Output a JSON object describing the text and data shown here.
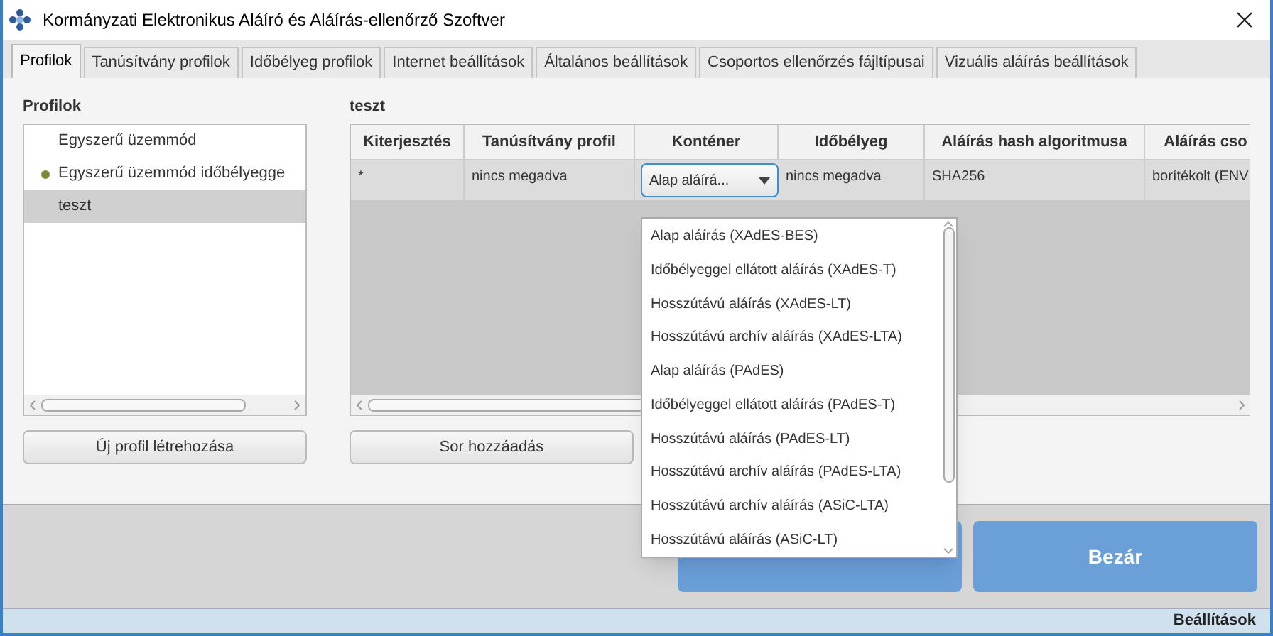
{
  "window": {
    "title": "Kormányzati Elektronikus Aláíró és Aláírás-ellenőrző Szoftver"
  },
  "tabs": [
    {
      "label": "Profilok",
      "selected": true
    },
    {
      "label": "Tanúsítvány profilok",
      "selected": false
    },
    {
      "label": "Időbélyeg profilok",
      "selected": false
    },
    {
      "label": "Internet beállítások",
      "selected": false
    },
    {
      "label": "Általános beállítások",
      "selected": false
    },
    {
      "label": "Csoportos ellenőrzés fájltípusai",
      "selected": false
    },
    {
      "label": "Vizuális aláírás beállítások",
      "selected": false
    }
  ],
  "profiles": {
    "heading": "Profilok",
    "items": [
      {
        "label": "Egyszerű üzemmód",
        "active": false,
        "selected": false
      },
      {
        "label": "Egyszerű üzemmód időbélyegge",
        "active": true,
        "selected": false
      },
      {
        "label": "teszt",
        "active": false,
        "selected": true
      }
    ],
    "button": "Új profil létrehozása"
  },
  "profile_detail": {
    "heading": "teszt",
    "table": {
      "columns": [
        "Kiterjesztés",
        "Tanúsítvány profil",
        "Konténer",
        "Időbélyeg",
        "Aláírás hash algoritmusa",
        "Aláírás cso"
      ],
      "rows": [
        [
          "*",
          "nincs megadva",
          {
            "kind": "combo",
            "value": "Alap aláírá..."
          },
          "nincs megadva",
          "SHA256",
          "borítékolt (ENV"
        ]
      ]
    },
    "button": "Sor hozzáadás"
  },
  "dropdown": {
    "options": [
      {
        "label": "Alap aláírás (XAdES-BES)",
        "selected": false
      },
      {
        "label": "Időbélyeggel ellátott aláírás (XAdES-T)",
        "selected": false
      },
      {
        "label": "Hosszútávú aláírás (XAdES-LT)",
        "selected": false
      },
      {
        "label": "Hosszútávú archív aláírás (XAdES-LTA)",
        "selected": false
      },
      {
        "label": "Alap aláírás (PAdES)",
        "selected": false
      },
      {
        "label": "Időbélyeggel ellátott aláírás (PAdES-T)",
        "selected": false
      },
      {
        "label": "Hosszútávú aláírás (PAdES-LT)",
        "selected": false
      },
      {
        "label": "Hosszútávú archív aláírás (PAdES-LTA)",
        "selected": false
      },
      {
        "label": "Hosszútávú archív aláírás (ASiC-LTA)",
        "selected": false
      },
      {
        "label": "Hosszútávú aláírás (ASiC-LT)",
        "selected": false
      }
    ]
  },
  "footer_button": "Bezár",
  "status_bar": "Beállítások"
}
